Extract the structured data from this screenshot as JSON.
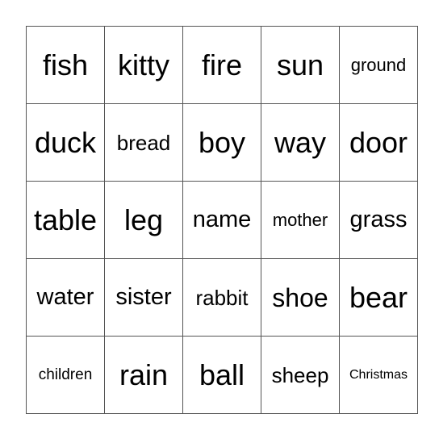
{
  "bingo": {
    "rows": [
      [
        "fish",
        "kitty",
        "fire",
        "sun",
        "ground"
      ],
      [
        "duck",
        "bread",
        "boy",
        "way",
        "door"
      ],
      [
        "table",
        "leg",
        "name",
        "mother",
        "grass"
      ],
      [
        "water",
        "sister",
        "rabbit",
        "shoe",
        "bear"
      ],
      [
        "children",
        "rain",
        "ball",
        "sheep",
        "Christmas"
      ]
    ]
  }
}
